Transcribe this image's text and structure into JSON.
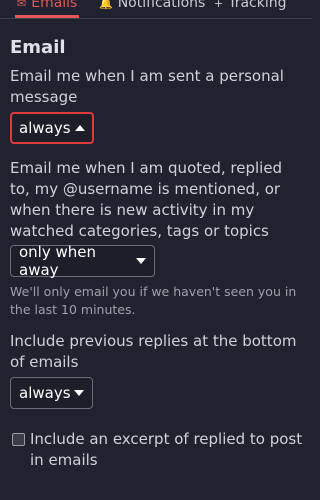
{
  "tabs": [
    {
      "label": "Emails",
      "icon": "envelope-icon",
      "active": true
    },
    {
      "label": "Notifications",
      "icon": "bell-icon"
    },
    {
      "label": "Tracking",
      "icon": "plus-icon"
    }
  ],
  "section": {
    "title": "Email"
  },
  "personal_message": {
    "label": "Email me when I am sent a personal message",
    "value": "always"
  },
  "activity": {
    "label": "Email me when I am quoted, replied to, my @username is mentioned, or when there is new activity in my watched categories, tags or topics",
    "value": "only when away",
    "hint": "We'll only email you if we haven't seen you in the last 10 minutes."
  },
  "previous_replies": {
    "label": "Include previous replies at the bottom of emails",
    "value": "always"
  },
  "excerpt": {
    "label": "Include an excerpt of replied to post in emails",
    "checked": false
  },
  "colors": {
    "background": "#212230",
    "accent": "#e45757",
    "focus_border": "#e03b3b"
  }
}
